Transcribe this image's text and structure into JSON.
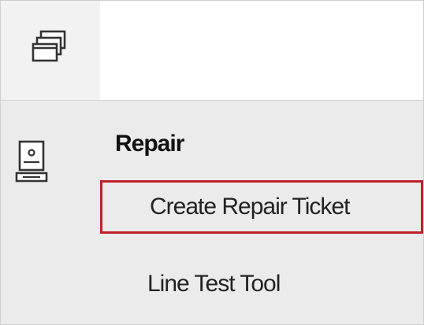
{
  "header": {
    "windows_icon": "windows-stack-icon"
  },
  "sidebar": {
    "device_icon": "computer-monitor-icon"
  },
  "menu": {
    "section_title": "Repair",
    "items": [
      {
        "label": "Create Repair Ticket",
        "highlighted": true
      },
      {
        "label": "Line Test Tool",
        "highlighted": false
      }
    ]
  },
  "colors": {
    "highlight_border": "#c0202a",
    "panel_background": "#ebebeb"
  }
}
